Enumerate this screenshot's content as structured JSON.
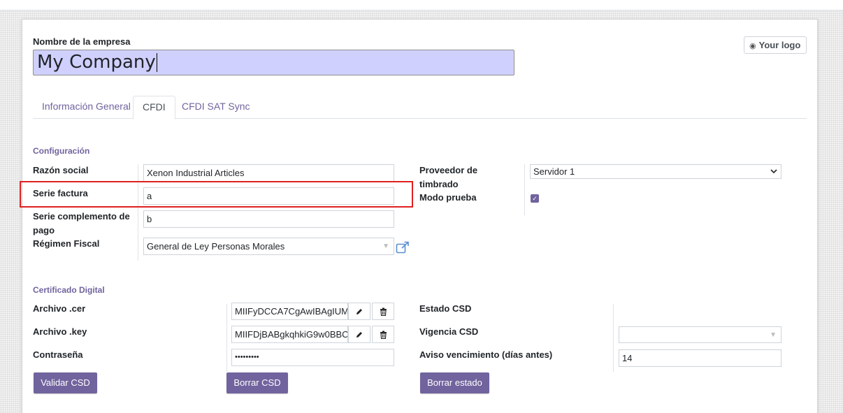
{
  "company": {
    "label": "Nombre de la empresa",
    "name": "My Company",
    "logo_button": "Your logo"
  },
  "tabs": [
    {
      "label": "Información General",
      "active": false
    },
    {
      "label": "CFDI",
      "active": true
    },
    {
      "label": "CFDI SAT Sync",
      "active": false
    }
  ],
  "configuracion": {
    "title": "Configuración",
    "razon_social": {
      "label": "Razón social",
      "value": "Xenon Industrial Articles"
    },
    "serie_factura": {
      "label": "Serie factura",
      "value": "a"
    },
    "serie_complemento": {
      "label": "Serie complemento de pago",
      "value": "b"
    },
    "regimen_fiscal": {
      "label": "Régimen Fiscal",
      "value": "General de Ley Personas Morales"
    },
    "proveedor": {
      "label": "Proveedor de timbrado",
      "value": "Servidor 1"
    },
    "modo_prueba": {
      "label": "Modo prueba",
      "checked": true
    }
  },
  "certificado": {
    "title": "Certificado Digital",
    "archivo_cer": {
      "label": "Archivo .cer",
      "value": "MIIFyDCCA7CgAwIBAgIUM"
    },
    "archivo_key": {
      "label": "Archivo .key",
      "value": "MIIFDjBABgkqhkiG9w0BBC"
    },
    "contrasena": {
      "label": "Contraseña",
      "value": "•••••••••"
    },
    "estado_csd": {
      "label": "Estado CSD",
      "value": ""
    },
    "vigencia_csd": {
      "label": "Vigencia CSD",
      "value": ""
    },
    "aviso": {
      "label": "Aviso vencimiento (días antes)",
      "value": "14"
    },
    "buttons": {
      "validar": "Validar CSD",
      "borrar_csd": "Borrar CSD",
      "borrar_estado": "Borrar estado"
    }
  },
  "icons": [
    "camera-icon",
    "external-link-icon",
    "pencil-icon",
    "trash-icon",
    "check-icon",
    "chevron-down-icon",
    "caret-down-icon"
  ],
  "colors": {
    "accent": "#71639e",
    "highlight": "#e02020",
    "company_input_bg": "#d0d0ff"
  }
}
